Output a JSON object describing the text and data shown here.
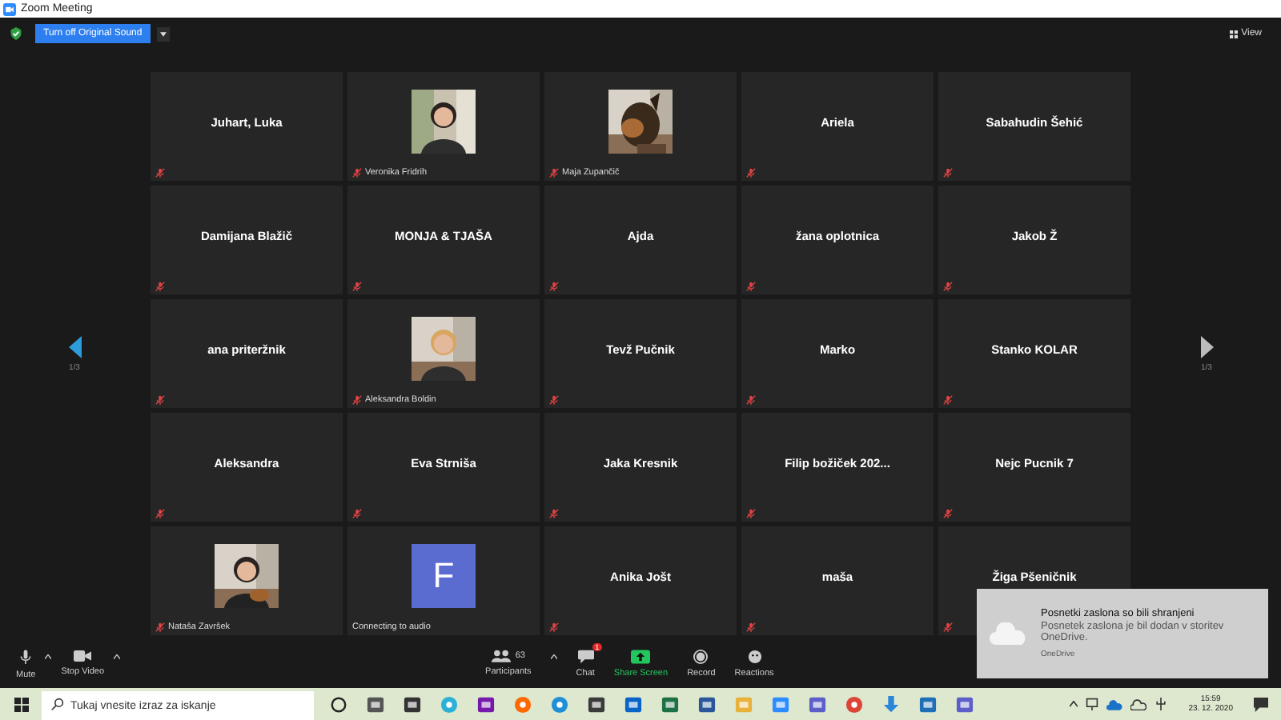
{
  "window": {
    "title": "Zoom Meeting"
  },
  "topbar": {
    "sound_button": "Turn off Original Sound",
    "view": "View"
  },
  "pager": {
    "left": "1/3",
    "right": "1/3"
  },
  "tiles": [
    {
      "kind": "name",
      "name": "Juhart, Luka",
      "muted": true
    },
    {
      "kind": "picture",
      "name": "Veronika Fridrih",
      "muted": true
    },
    {
      "kind": "picture",
      "name": "Maja Zupančič",
      "muted": true
    },
    {
      "kind": "name",
      "name": "Ariela",
      "muted": true
    },
    {
      "kind": "name",
      "name": "Sabahudin Šehić",
      "muted": true
    },
    {
      "kind": "name",
      "name": "Damijana Blažič",
      "muted": true
    },
    {
      "kind": "name",
      "name": "MONJA & TJAŠA",
      "muted": true
    },
    {
      "kind": "name",
      "name": "Ajda",
      "muted": true
    },
    {
      "kind": "name",
      "name": "žana oplotnica",
      "muted": true
    },
    {
      "kind": "name",
      "name": "Jakob Ž",
      "muted": true
    },
    {
      "kind": "name",
      "name": "ana priteržnik",
      "muted": true
    },
    {
      "kind": "picture",
      "name": "Aleksandra Boldin",
      "muted": true
    },
    {
      "kind": "name",
      "name": "Tevž Pučnik",
      "muted": true
    },
    {
      "kind": "name",
      "name": "Marko",
      "muted": true
    },
    {
      "kind": "name",
      "name": "Stanko KOLAR",
      "muted": true
    },
    {
      "kind": "name",
      "name": "Aleksandra",
      "muted": true
    },
    {
      "kind": "name",
      "name": "Eva Strniša",
      "muted": true
    },
    {
      "kind": "name",
      "name": "Jaka Kresnik",
      "muted": true
    },
    {
      "kind": "name",
      "name": "Filip božiček 202...",
      "muted": true
    },
    {
      "kind": "name",
      "name": "Nejc Pucnik 7",
      "muted": true
    },
    {
      "kind": "picture",
      "name": "Nataša Završek",
      "muted": true
    },
    {
      "kind": "avatar",
      "letter": "F",
      "name": "Connecting to audio",
      "muted": false
    },
    {
      "kind": "name",
      "name": "Anika Jošt",
      "muted": true
    },
    {
      "kind": "name",
      "name": "maša",
      "muted": true
    },
    {
      "kind": "name",
      "name": "Žiga Pšeničnik",
      "muted": true
    }
  ],
  "toolbar": {
    "mute": "Mute",
    "video": "Stop Video",
    "participants": "Participants",
    "participants_count": "63",
    "chat": "Chat",
    "chat_badge": "1",
    "share": "Share Screen",
    "record": "Record",
    "reactions": "Reactions"
  },
  "toast": {
    "title": "Posnetki zaslona so bili shranjeni",
    "body": "Posnetek zaslona je bil dodan v storitev OneDrive.",
    "source": "OneDrive"
  },
  "taskbar": {
    "search_placeholder": "Tukaj vnesite izraz za iskanje",
    "time": "15:59",
    "date": "23. 12. 2020"
  }
}
